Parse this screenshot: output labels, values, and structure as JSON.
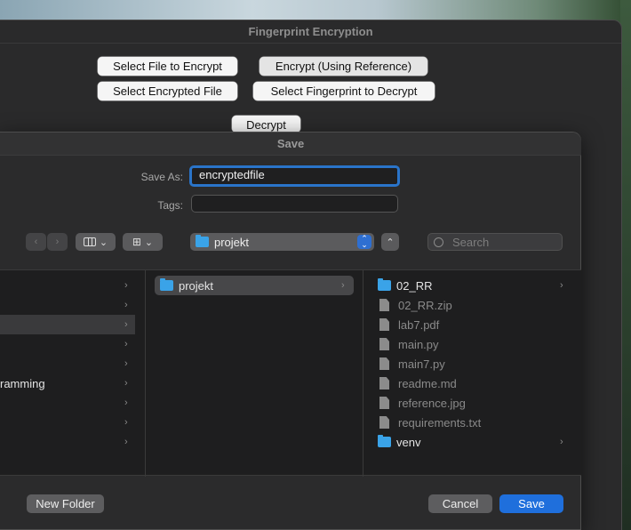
{
  "app": {
    "title": "Fingerprint Encryption",
    "buttons": {
      "select_file": "Select File to Encrypt",
      "encrypt_ref": "Encrypt (Using Reference)",
      "select_encrypted": "Select Encrypted File",
      "select_fingerprint": "Select Fingerprint to Decrypt",
      "decrypt": "Decrypt"
    }
  },
  "save_dialog": {
    "title": "Save",
    "save_as_label": "Save As:",
    "save_as_value": "encryptedfile",
    "tags_label": "Tags:",
    "tags_value": "",
    "location": "projekt",
    "search_placeholder": "Search",
    "sidebar_items": [
      "",
      "",
      "",
      "",
      "",
      "ramming",
      "",
      "",
      ""
    ],
    "column2": [
      {
        "name": "projekt",
        "type": "folder"
      }
    ],
    "column3": [
      {
        "name": "02_RR",
        "type": "folder",
        "enabled": true
      },
      {
        "name": "02_RR.zip",
        "type": "file",
        "enabled": false
      },
      {
        "name": "lab7.pdf",
        "type": "file",
        "enabled": false
      },
      {
        "name": "main.py",
        "type": "file",
        "enabled": false
      },
      {
        "name": "main7.py",
        "type": "file",
        "enabled": false
      },
      {
        "name": "readme.md",
        "type": "file",
        "enabled": false
      },
      {
        "name": "reference.jpg",
        "type": "file",
        "enabled": false
      },
      {
        "name": "requirements.txt",
        "type": "file",
        "enabled": false
      },
      {
        "name": "venv",
        "type": "folder",
        "enabled": true
      }
    ],
    "new_folder_label": "New Folder",
    "cancel_label": "Cancel",
    "save_label": "Save"
  },
  "colors": {
    "accent": "#1f6fdc",
    "folder": "#3aa3e8",
    "focus_ring": "#2a74c9"
  }
}
